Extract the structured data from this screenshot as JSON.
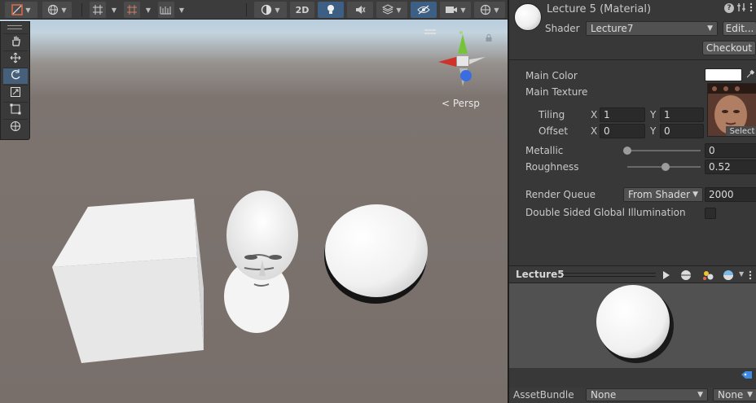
{
  "scene_toolbar": {
    "btn_2d_label": "2D"
  },
  "gizmo": {
    "projection_label": "< Persp"
  },
  "inspector": {
    "title": "Lecture 5 (Material)",
    "shader_label": "Shader",
    "shader_value": "Lecture7",
    "edit_label": "Edit...",
    "checkout_label": "Checkout",
    "main_color_label": "Main Color",
    "main_texture_label": "Main Texture",
    "tiling_label": "Tiling",
    "offset_label": "Offset",
    "x_label": "X",
    "y_label": "Y",
    "tiling_x": "1",
    "tiling_y": "1",
    "offset_x": "0",
    "offset_y": "0",
    "select_label": "Select",
    "metallic_label": "Metallic",
    "metallic_value": "0",
    "metallic_fraction": 0.0,
    "roughness_label": "Roughness",
    "roughness_value": "0.52",
    "roughness_fraction": 0.52,
    "render_queue_label": "Render Queue",
    "render_queue_mode": "From Shader",
    "render_queue_value": "2000",
    "double_sided_label": "Double Sided Global Illumination",
    "double_sided_checked": false
  },
  "preview": {
    "title": "Lecture5"
  },
  "asset_bundle": {
    "label": "AssetBundle",
    "name_value": "None",
    "variant_value": "None"
  },
  "colors": {
    "main_color": "#ffffff",
    "active_button": "#3d5f84",
    "x_axis": "#d0322a",
    "y_axis": "#76c43a",
    "z_axis": "#3a6ee0"
  }
}
